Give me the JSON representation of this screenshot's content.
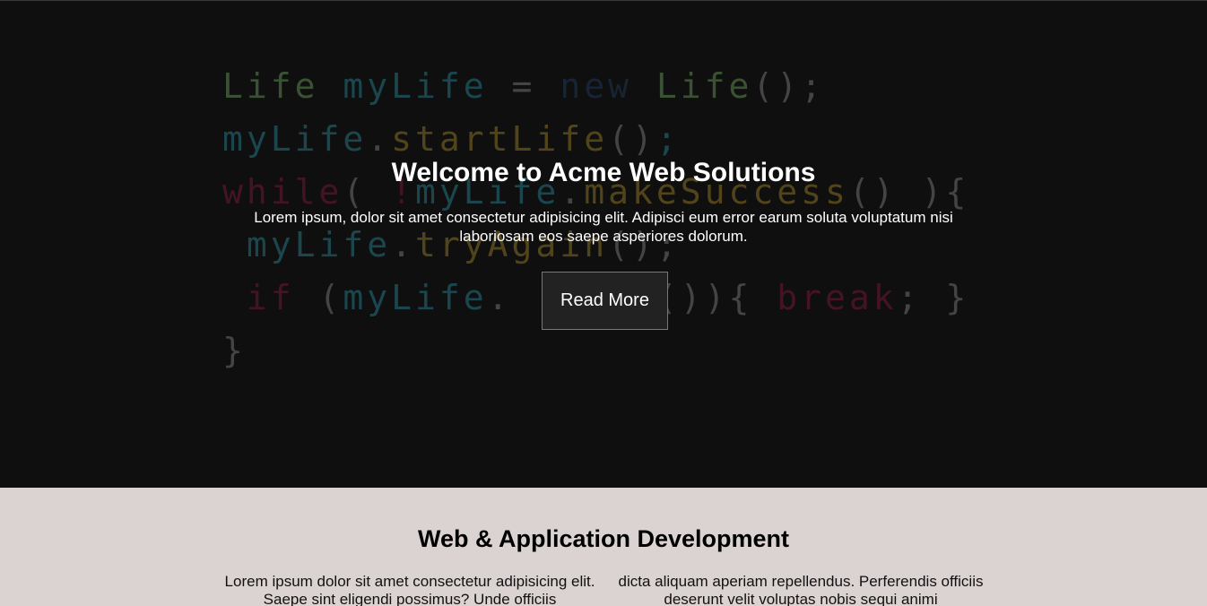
{
  "hero": {
    "code_lines": [
      [
        {
          "t": "Life ",
          "c": "green"
        },
        {
          "t": "myLife ",
          "c": "teal"
        },
        {
          "t": "= ",
          "c": "grey"
        },
        {
          "t": "new ",
          "c": "navy"
        },
        {
          "t": "Life",
          "c": "green"
        },
        {
          "t": "();",
          "c": "grey"
        }
      ],
      [
        {
          "t": "myLife",
          "c": "teal"
        },
        {
          "t": ".",
          "c": "grey"
        },
        {
          "t": "startLife",
          "c": "yellow"
        },
        {
          "t": "()",
          "c": "grey"
        },
        {
          "t": ";",
          "c": "teal"
        }
      ],
      [
        {
          "t": "while",
          "c": "red"
        },
        {
          "t": "( ",
          "c": "grey"
        },
        {
          "t": "!",
          "c": "red"
        },
        {
          "t": "myLife",
          "c": "teal"
        },
        {
          "t": ".",
          "c": "grey"
        },
        {
          "t": "makeSuccess",
          "c": "yellow"
        },
        {
          "t": "() ){",
          "c": "grey"
        }
      ],
      [
        {
          "t": " myLife",
          "c": "teal"
        },
        {
          "t": ".",
          "c": "grey"
        },
        {
          "t": "tryAgain",
          "c": "yellow"
        },
        {
          "t": "();",
          "c": "grey"
        }
      ],
      [
        {
          "t": " if ",
          "c": "red"
        },
        {
          "t": "(",
          "c": "grey"
        },
        {
          "t": "myLife",
          "c": "teal"
        },
        {
          "t": ".",
          "c": "grey"
        },
        {
          "t": "      ",
          "c": "grey"
        },
        {
          "t": "()){ ",
          "c": "grey"
        },
        {
          "t": "break",
          "c": "red"
        },
        {
          "t": "; }",
          "c": "grey"
        }
      ],
      [
        {
          "t": "}",
          "c": "grey"
        }
      ]
    ],
    "title": "Welcome to Acme Web Solutions",
    "text": "Lorem ipsum, dolor sit amet consectetur adipisicing elit. Adipisci eum error earum soluta voluptatum nisi laboriosam eos saepe asperiores dolorum.",
    "button_label": "Read More"
  },
  "section": {
    "title": "Web & Application Development",
    "col_left": "Lorem ipsum dolor sit amet consectetur adipisicing elit. Saepe sint eligendi possimus? Unde officiis",
    "col_right": "dicta aliquam aperiam repellendus. Perferendis officiis deserunt velit voluptas nobis sequi animi"
  },
  "colors": {
    "hero_bg": "#0f0f0f",
    "section_bg": "#dbd3d2",
    "button_bg": "#222222",
    "button_border": "#777777"
  }
}
